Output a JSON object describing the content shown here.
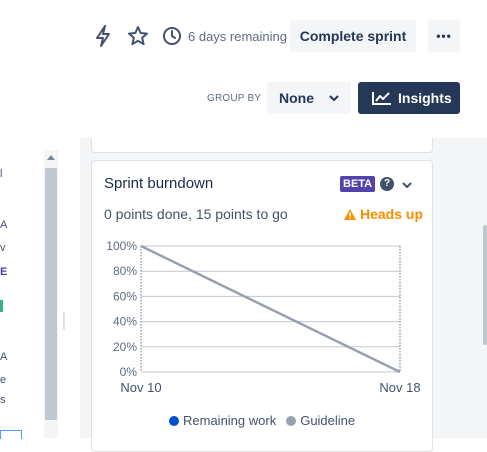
{
  "header": {
    "days_remaining": "6 days remaining",
    "complete_sprint": "Complete sprint",
    "more": "•••"
  },
  "group_by": {
    "label": "GROUP BY",
    "value": "None"
  },
  "insights_button": "Insights",
  "left_fragment": [
    "l",
    "A",
    "v",
    "E",
    "A",
    "e",
    "s"
  ],
  "card": {
    "title": "Sprint burndown",
    "badge": "BETA",
    "summary": "0 points done, 15 points to go",
    "heads_up": "Heads up"
  },
  "colors": {
    "remaining": "#0052cc",
    "guideline": "#97a0af",
    "warning": "#ff8b00",
    "badge": "#5243aa",
    "insights_bg": "#253858"
  },
  "chart_data": {
    "type": "line",
    "x": [
      "Nov 10",
      "Nov 18"
    ],
    "ylim": [
      0,
      100
    ],
    "y_ticks": [
      "100%",
      "80%",
      "60%",
      "40%",
      "20%",
      "0%"
    ],
    "series": [
      {
        "name": "Remaining work",
        "values": []
      },
      {
        "name": "Guideline",
        "values": [
          100,
          0
        ]
      }
    ],
    "legend": {
      "position": "bottom"
    }
  }
}
